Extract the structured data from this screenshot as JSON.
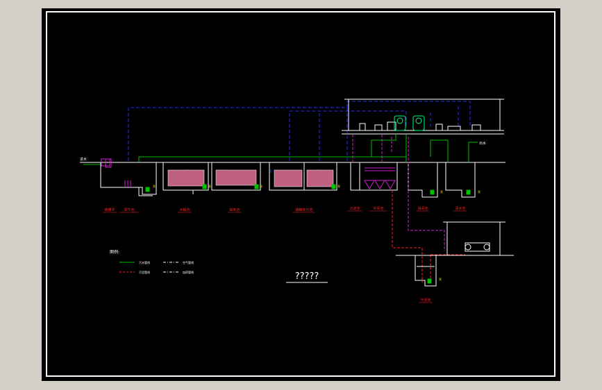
{
  "drawing": {
    "title": "?????",
    "colors": {
      "outer_background": "#d4d0c8",
      "canvas": "#000000",
      "border": "#ffffff",
      "water_line": "#00c000",
      "sludge_line": "#ff2020",
      "air_line": "#0000ff",
      "dosing_line": "#d020d0",
      "label_text": "#ff2020",
      "note_text": "#e0e000"
    },
    "legend": {
      "title": "图例:",
      "items": [
        {
          "key": "water",
          "label": "污水管线"
        },
        {
          "key": "sludge",
          "label": "污泥管线"
        },
        {
          "key": "air",
          "label": "空气管线"
        },
        {
          "key": "dosing",
          "label": "加药管线"
        }
      ]
    },
    "units": [
      {
        "key": "screen",
        "label": "格栅井"
      },
      {
        "key": "equalization",
        "label": "调节池"
      },
      {
        "key": "hydrolysis",
        "label": "水解池"
      },
      {
        "key": "anoxic",
        "label": "缺氧池"
      },
      {
        "key": "contact_oxidation",
        "label": "接触氧化池"
      },
      {
        "key": "settling",
        "label": "沉淀池"
      },
      {
        "key": "disinfection",
        "label": "消毒池"
      },
      {
        "key": "intermediate",
        "label": "中间池"
      },
      {
        "key": "clear_water",
        "label": "清水池"
      },
      {
        "key": "sludge_tank",
        "label": "污泥池"
      }
    ],
    "annotations": {
      "inlet": "进水",
      "outlet": "出水",
      "pump_tag": "泵"
    }
  }
}
